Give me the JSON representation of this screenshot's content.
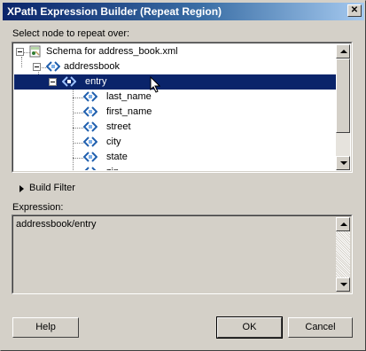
{
  "window": {
    "title": "XPath Expression Builder (Repeat Region)",
    "close_label": "✕"
  },
  "select_label": "Select node to repeat over:",
  "tree": {
    "root": "Schema for address_book.xml",
    "nodes": [
      {
        "label": "addressbook"
      },
      {
        "label": "entry",
        "selected": true
      },
      {
        "label": "last_name"
      },
      {
        "label": "first_name"
      },
      {
        "label": "street"
      },
      {
        "label": "city"
      },
      {
        "label": "state"
      },
      {
        "label": "zip"
      }
    ]
  },
  "build_filter_label": "Build Filter",
  "expression": {
    "label": "Expression:",
    "value": "addressbook/entry"
  },
  "buttons": {
    "help": "Help",
    "ok": "OK",
    "cancel": "Cancel"
  },
  "colors": {
    "selection": "#0a246a",
    "titlebar": "#0a246a",
    "face": "#d4d0c8"
  }
}
